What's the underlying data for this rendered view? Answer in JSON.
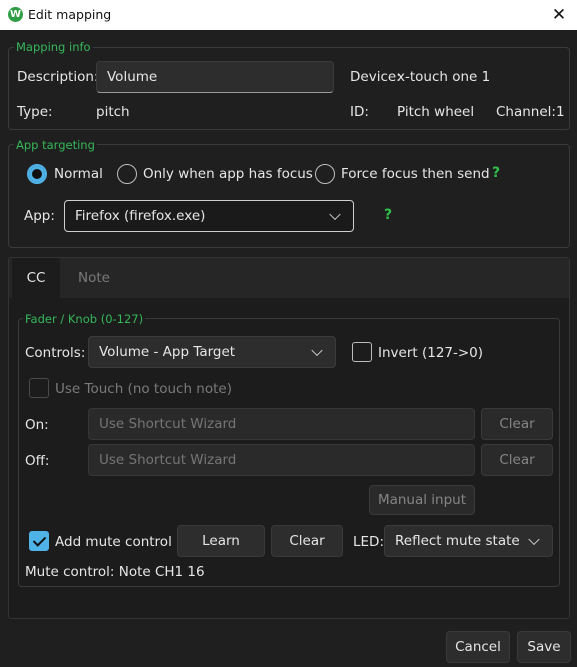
{
  "window": {
    "title": "Edit mapping",
    "icon_letter": "W",
    "close_glyph": "✕"
  },
  "mapping_info": {
    "legend": "Mapping info",
    "description_label": "Description:",
    "description_value": "Volume",
    "device_label": "Device:",
    "device_value": "x-touch one 1",
    "type_label": "Type:",
    "type_value": "pitch",
    "id_label": "ID:",
    "id_value": "Pitch wheel",
    "channel_label": "Channel:",
    "channel_value": "1"
  },
  "app_targeting": {
    "legend": "App targeting",
    "options": [
      "Normal",
      "Only when app has focus",
      "Force focus then send"
    ],
    "selected": "Normal",
    "help_glyph": "?",
    "app_label": "App:",
    "app_value": "Firefox (firefox.exe)"
  },
  "tabs": [
    "CC",
    "Note"
  ],
  "active_tab": "CC",
  "cc": {
    "legend": "Fader / Knob (0-127)",
    "controls_label": "Controls:",
    "controls_value": "Volume - App Target",
    "invert_label": "Invert (127->0)",
    "invert_checked": false,
    "use_touch_label": "Use Touch (no touch note)",
    "use_touch_checked": false,
    "on_label": "On:",
    "on_placeholder": "Use Shortcut Wizard",
    "off_label": "Off:",
    "off_placeholder": "Use Shortcut Wizard",
    "clear_label": "Clear",
    "manual_input_label": "Manual input",
    "add_mute_label": "Add mute control",
    "add_mute_checked": true,
    "learn_label": "Learn",
    "mute_clear_label": "Clear",
    "led_label": "LED:",
    "led_value": "Reflect mute state",
    "mute_status": "Mute control: Note CH1 16"
  },
  "footer": {
    "cancel_label": "Cancel",
    "save_label": "Save"
  },
  "colors": {
    "accent": "#4fb3e8",
    "legend": "#35b85a",
    "help": "#2fbf4a",
    "background": "#1f1f1f"
  }
}
